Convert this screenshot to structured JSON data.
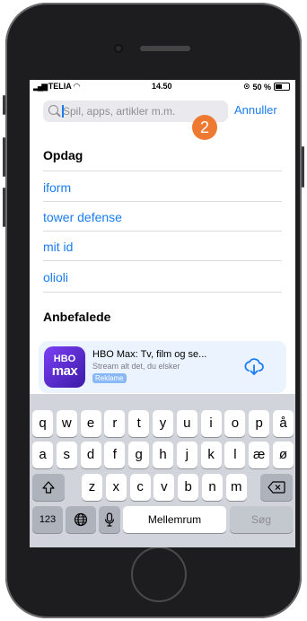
{
  "status_bar": {
    "carrier": "TELIA",
    "time": "14.50",
    "battery": "50 %"
  },
  "search": {
    "placeholder": "Spil, apps, artikler m.m.",
    "value": "",
    "cancel_label": "Annuller",
    "step_badge": "2"
  },
  "discover": {
    "heading": "Opdag",
    "suggestions": [
      "iform",
      "tower defense",
      "mit id",
      "olioli"
    ]
  },
  "recommended": {
    "heading": "Anbefalede",
    "app": {
      "icon_line1": "HBO",
      "icon_line2": "max",
      "title": "HBO Max: Tv, film og se...",
      "subtitle": "Stream alt det, du elsker",
      "ad_label": "Reklame",
      "action_icon": "cloud-download-icon"
    }
  },
  "keyboard": {
    "row1": [
      "q",
      "w",
      "e",
      "r",
      "t",
      "y",
      "u",
      "i",
      "o",
      "p",
      "å"
    ],
    "row2": [
      "a",
      "s",
      "d",
      "f",
      "g",
      "h",
      "j",
      "k",
      "l",
      "æ",
      "ø"
    ],
    "row3": [
      "z",
      "x",
      "c",
      "v",
      "b",
      "n",
      "m"
    ],
    "numbers_label": "123",
    "space_label": "Mellemrum",
    "search_label": "Søg",
    "shift_icon": "shift-icon",
    "delete_icon": "delete-icon",
    "globe_icon": "globe-icon",
    "mic_icon": "microphone-icon"
  },
  "colors": {
    "accent": "#1a7cf5",
    "badge": "#ee7a32",
    "card_bg": "#eaf3fe"
  }
}
